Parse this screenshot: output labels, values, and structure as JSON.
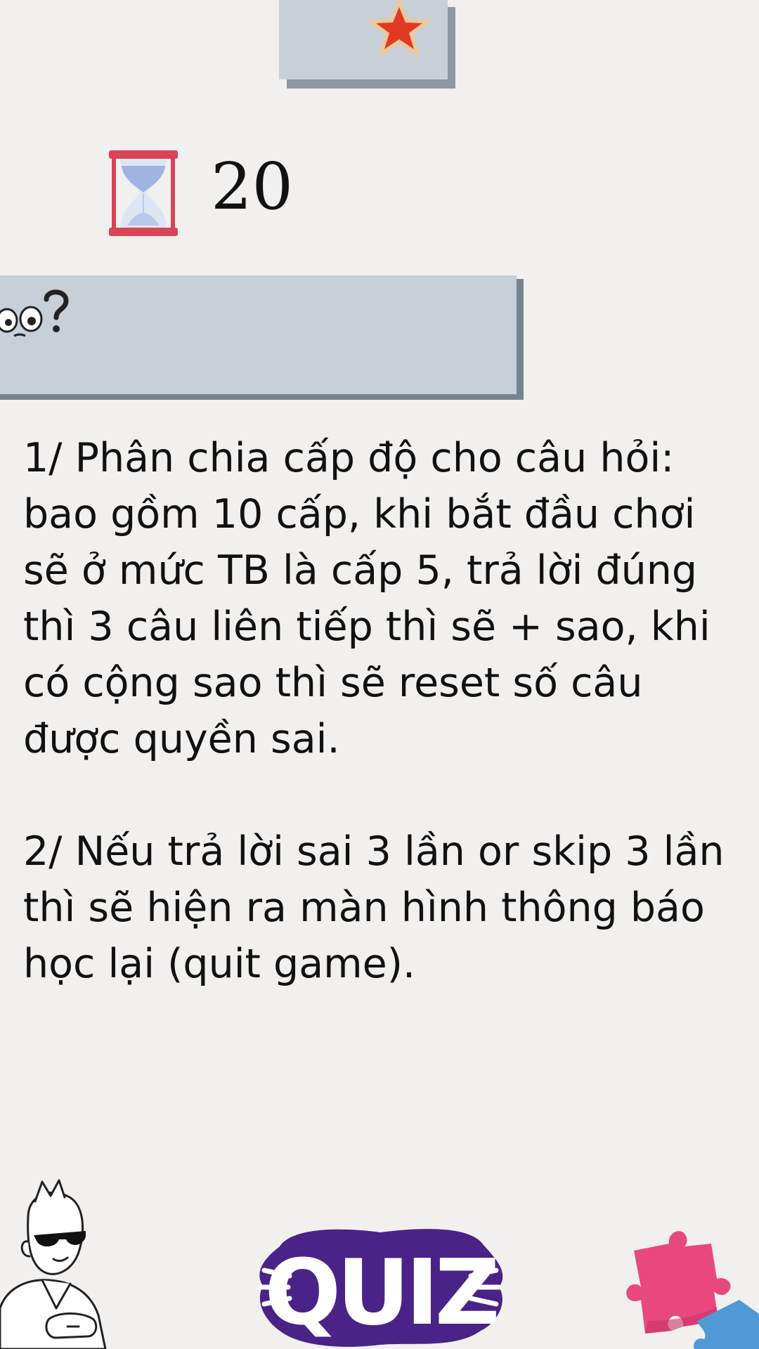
{
  "timer": {
    "value": "20"
  },
  "rules": {
    "rule1": "1/ Phân chia cấp độ cho câu hỏi: bao gồm 10 cấp, khi bắt đầu chơi sẽ ở mức TB là cấp 5, trả lời đúng thì 3 câu liên tiếp thì sẽ + sao, khi có cộng sao thì sẽ reset số câu được quyền sai.",
    "rule2": "2/ Nếu trả lời sai 3 lần or skip 3 lần thì sẽ hiện ra màn hình thông báo học lại (quit game)."
  },
  "logo": {
    "text": "QUIZ"
  },
  "icons": {
    "star": "star-icon",
    "hourglass": "hourglass-icon",
    "thinking": "thinking-face-icon",
    "gamer": "gamer-illustration",
    "puzzle": "puzzle-icon"
  },
  "colors": {
    "background": "#f1f0ef",
    "card": "#c7cfd9",
    "card_shadow": "#8f98a1",
    "star_red": "#e23a22",
    "hourglass_frame": "#d94556",
    "hourglass_sand": "#9fb4e0",
    "quiz_purple": "#4a2388",
    "puzzle_pink": "#e8487e",
    "puzzle_blue": "#4f9ad6"
  }
}
